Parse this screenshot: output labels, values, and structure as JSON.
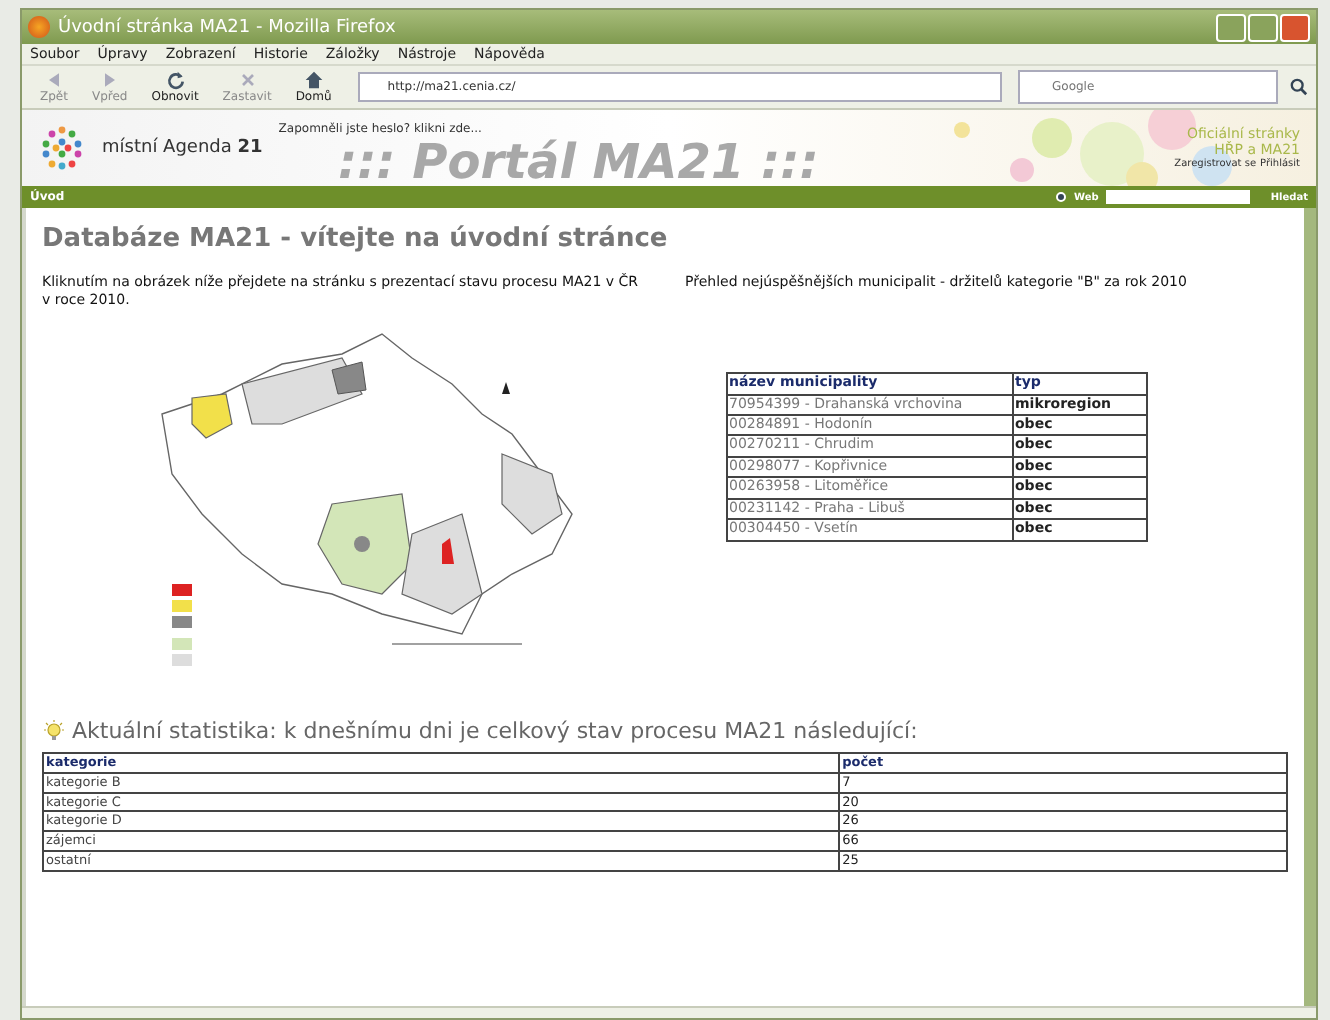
{
  "window": {
    "title": "Úvodní stránka MA21 - Mozilla Firefox"
  },
  "menu": [
    "Soubor",
    "Úpravy",
    "Zobrazení",
    "Historie",
    "Záložky",
    "Nástroje",
    "Nápověda"
  ],
  "toolbar": [
    {
      "kind": "back",
      "label": "Zpět",
      "disabled": true
    },
    {
      "kind": "forward",
      "label": "Vpřed",
      "disabled": true
    },
    {
      "kind": "reload",
      "label": "Obnovit",
      "disabled": false
    },
    {
      "kind": "stop",
      "label": "Zastavit",
      "disabled": true
    },
    {
      "kind": "home",
      "label": "Domů",
      "disabled": false
    }
  ],
  "address": {
    "value": "http://ma21.cenia.cz/"
  },
  "browser_search": {
    "placeholder": "Google"
  },
  "site_header": {
    "logo_text": "místní Agenda **21**",
    "forgot": "Zapomněli jste heslo? klikni zde...",
    "portal_title": "::: Portál MA21 :::",
    "official_1": "Oficiální stránky",
    "official_2": "HŘP a MA21",
    "register": "Zaregistrovat se",
    "login": "Přihlásit"
  },
  "nav": {
    "home": "Úvod",
    "web_radio": {
      "checked": true
    },
    "search_label": "Web",
    "search_button": "Hledat"
  },
  "page": {
    "heading": "Databáze MA21 - vítejte na úvodní stránce",
    "intro": "Kliknutím na obrázek níže přejdete na stránku s prezentací stavu procesu MA21 v ČR v roce 2010.",
    "top_caption": "Přehled nejúspěšnějších municipalit - držitelů kategorie \"B\" za rok 2010",
    "top_table": {
      "columns": [
        "název municipality",
        "typ"
      ],
      "rows": [
        [
          "70954399 - Drahanská vrchovina",
          "mikroregion"
        ],
        [
          "00284891 - Hodonín",
          "obec"
        ],
        [
          "00270211 - Chrudim",
          "obec"
        ],
        [
          "00298077 - Kopřivnice",
          "obec"
        ],
        [
          "00263958 - Litoměřice",
          "obec"
        ],
        [
          "00231142 - Praha - Libuš",
          "obec"
        ],
        [
          "00304450 - Vsetín",
          "obec"
        ]
      ]
    },
    "stats_heading": "Aktuální statistika: k dnešnímu dni je celkový stav procesu MA21 následující:",
    "stats_table": {
      "columns": [
        "kategorie",
        "počet"
      ],
      "rows": [
        [
          "kategorie B",
          "7"
        ],
        [
          "kategorie C",
          "20"
        ],
        [
          "kategorie D",
          "26"
        ],
        [
          "zájemci",
          "66"
        ],
        [
          "ostatní",
          "25"
        ]
      ]
    }
  }
}
